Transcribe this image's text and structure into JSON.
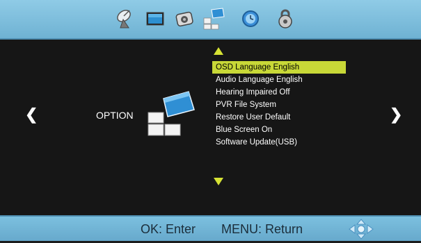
{
  "tabs": [
    {
      "icon": "satellite-dish-icon"
    },
    {
      "icon": "picture-icon"
    },
    {
      "icon": "sound-icon"
    },
    {
      "icon": "option-icon",
      "selected": true
    },
    {
      "icon": "clock-icon"
    },
    {
      "icon": "lock-icon"
    }
  ],
  "nav": {
    "left_arrow": "❮",
    "right_arrow": "❯"
  },
  "section_label": "OPTION",
  "menu": {
    "items": [
      {
        "label": "OSD Language English",
        "selected": true
      },
      {
        "label": "Audio Language English"
      },
      {
        "label": "Hearing Impaired Off"
      },
      {
        "label": "PVR File System"
      },
      {
        "label": "Restore User Default"
      },
      {
        "label": "Blue Screen On"
      },
      {
        "label": "Software Update(USB)"
      }
    ]
  },
  "footer": {
    "ok_hint": "OK: Enter",
    "menu_hint": "MENU: Return"
  },
  "colors": {
    "bar_blue": "#7cc0df",
    "highlight": "#c8d837",
    "arrow_yellow": "#d6e234",
    "background": "#161616"
  }
}
